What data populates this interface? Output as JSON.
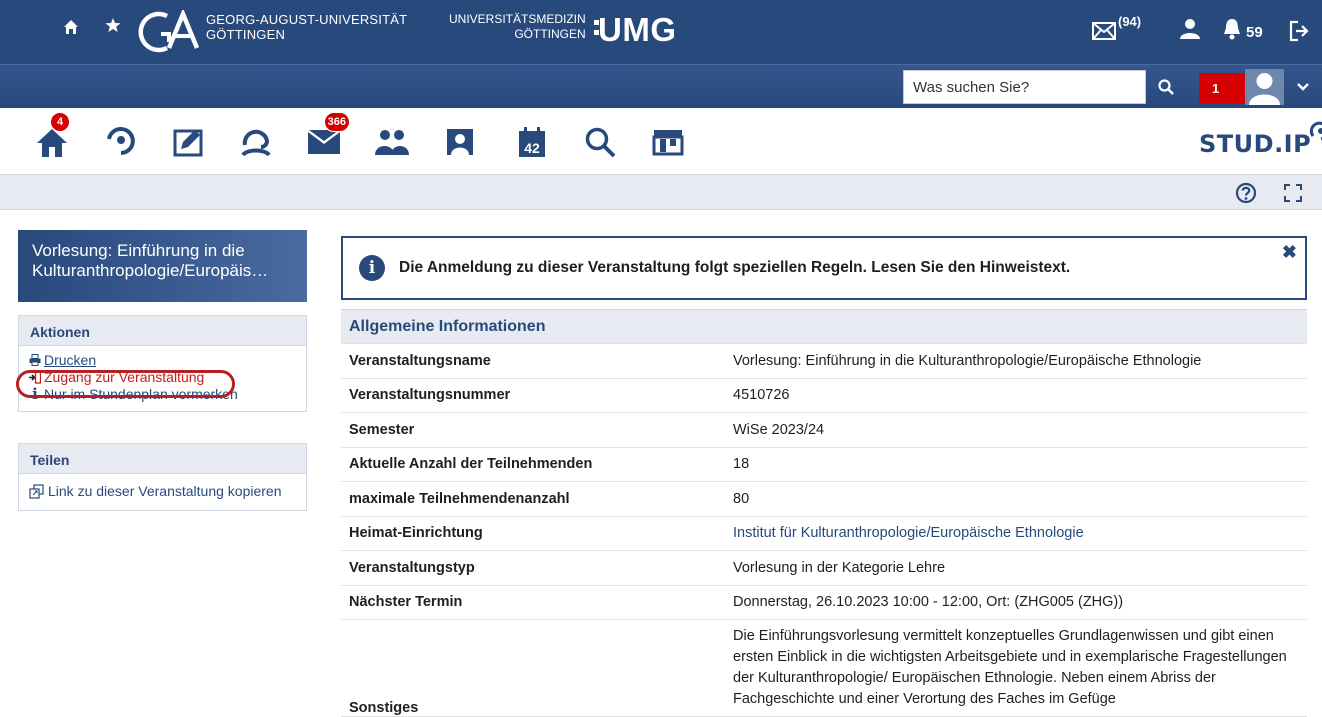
{
  "topbar": {
    "uni_line1": "GEORG-AUGUST-UNIVERSITÄT",
    "uni_line2": "GÖTTINGEN",
    "umg_line1": "UNIVERSITÄTSMEDIZIN",
    "umg_line2": "GÖTTINGEN",
    "umg_mark": "UMG",
    "mail_count": "(94)",
    "notification_count": "59"
  },
  "searchbar": {
    "placeholder": "Was suchen Sie?",
    "badge": "1"
  },
  "nav": {
    "home_badge": "4",
    "messages_badge": "366",
    "calendar_number": "42"
  },
  "brand": {
    "logo_text": "STUD.IP"
  },
  "sidebar": {
    "course_title_line1": "Vorlesung: Einführung in die",
    "course_title_line2": "Kulturanthropologie/Europäis…",
    "actions_title": "Aktionen",
    "actions": [
      {
        "label": "Drucken"
      },
      {
        "label": "Zugang zur Veranstaltung"
      },
      {
        "label": "Nur im Stundenplan vormerken"
      }
    ],
    "share_title": "Teilen",
    "share_items": [
      {
        "label": "Link zu dieser Veranstaltung kopieren"
      }
    ]
  },
  "infobox": {
    "message": "Die Anmeldung zu dieser Veranstaltung folgt speziellen Regeln. Lesen Sie den Hinweistext."
  },
  "details": {
    "section_title": "Allgemeine Informationen",
    "rows": [
      {
        "key": "Veranstaltungsname",
        "value": "Vorlesung: Einführung in die Kulturanthropologie/Europäische Ethnologie"
      },
      {
        "key": "Veranstaltungsnummer",
        "value": "4510726"
      },
      {
        "key": "Semester",
        "value": "WiSe 2023/24"
      },
      {
        "key": "Aktuelle Anzahl der Teilnehmenden",
        "value": "18"
      },
      {
        "key": "maximale Teilnehmendenanzahl",
        "value": "80"
      },
      {
        "key": "Heimat-Einrichtung",
        "value": "Institut für Kulturanthropologie/Europäische Ethnologie"
      },
      {
        "key": "Veranstaltungstyp",
        "value": "Vorlesung in der Kategorie Lehre"
      },
      {
        "key": "Nächster Termin",
        "value": "Donnerstag, 26.10.2023 10:00 - 12:00, Ort: (ZHG005 (ZHG))"
      },
      {
        "key": "Sonstiges",
        "value": "Die Einführungsvorlesung vermittelt konzeptuelles Grundlagenwissen und gibt einen ersten Einblick in die wichtigsten Arbeitsgebiete und in exemplarische Fragestellungen der Kulturanthropologie/ Europäischen Ethnologie. Neben einem Abriss der Fachgeschichte und einer Verortung des Faches im Gefüge"
      }
    ]
  },
  "colors": {
    "brand_blue": "#28497c",
    "alert_red": "#d60000",
    "panel_gray": "#e7ebf1"
  }
}
